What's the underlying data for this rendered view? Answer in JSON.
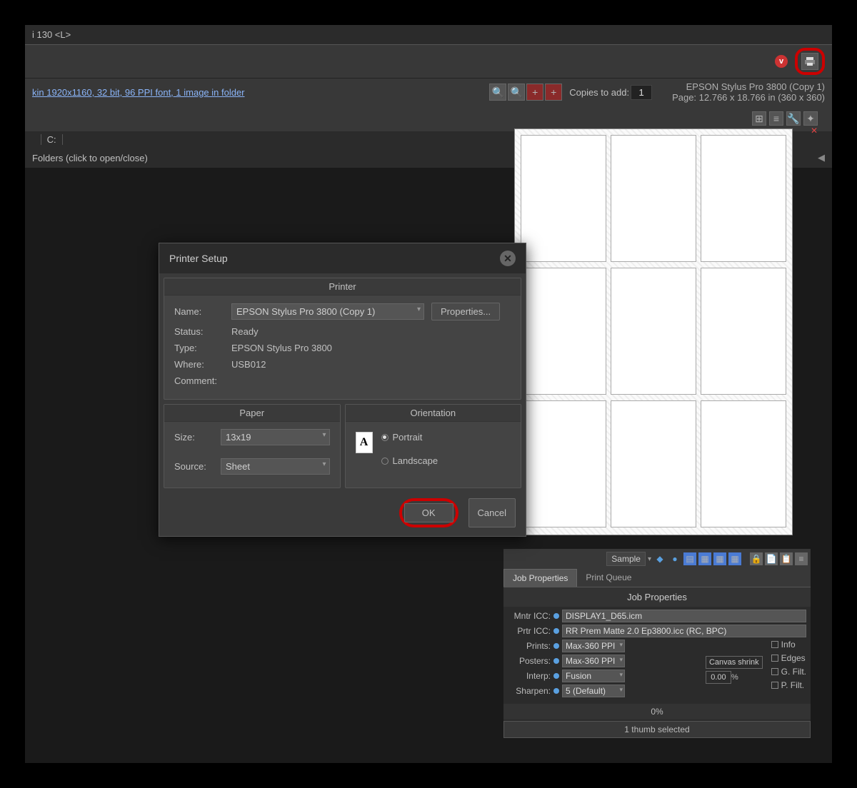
{
  "titlebar": "i 130 <L>",
  "header": {
    "info_link": "kin  1920x1160, 32 bit, 96 PPI font, 1 image in folder",
    "printer": "EPSON Stylus Pro 3800 (Copy 1)",
    "page": "Page: 12.766 x 18.766 in   (360 x 360)"
  },
  "copies": {
    "label": "Copies to add:",
    "value": "1"
  },
  "path": {
    "c_label": "C:"
  },
  "folders_row": "Folders (click to open/close)",
  "dialog": {
    "title": "Printer Setup",
    "printer_section": "Printer",
    "name_label": "Name:",
    "name_value": "EPSON Stylus Pro 3800 (Copy 1)",
    "properties_btn": "Properties...",
    "status_label": "Status:",
    "status_value": "Ready",
    "type_label": "Type:",
    "type_value": "EPSON Stylus Pro 3800",
    "where_label": "Where:",
    "where_value": "USB012",
    "comment_label": "Comment:",
    "paper_section": "Paper",
    "size_label": "Size:",
    "size_value": "13x19",
    "source_label": "Source:",
    "source_value": "Sheet",
    "orient_section": "Orientation",
    "orient_icon": "A",
    "portrait": "Portrait",
    "landscape": "Landscape",
    "ok": "OK",
    "cancel": "Cancel"
  },
  "bottom": {
    "sample": "Sample",
    "tab_job": "Job Properties",
    "tab_queue": "Print Queue",
    "jp_title": "Job Properties",
    "mntr_label": "Mntr ICC:",
    "mntr_value": "DISPLAY1_D65.icm",
    "prtr_label": "Prtr ICC:",
    "prtr_value": "RR Prem Matte 2.0 Ep3800.icc (RC, BPC)",
    "prints_label": "Prints:",
    "prints_value": "Max-360 PPI",
    "posters_label": "Posters:",
    "posters_value": "Max-360 PPI",
    "interp_label": "Interp:",
    "interp_value": "Fusion",
    "sharpen_label": "Sharpen:",
    "sharpen_value": "5 (Default)",
    "canvas_label": "Canvas shrink",
    "canvas_value": "0.00",
    "canvas_unit": "%",
    "chk_info": "Info",
    "chk_edges": "Edges",
    "chk_gfilt": "G. Filt.",
    "chk_pfilt": "P. Filt.",
    "progress": "0%",
    "status": "1 thumb selected"
  }
}
